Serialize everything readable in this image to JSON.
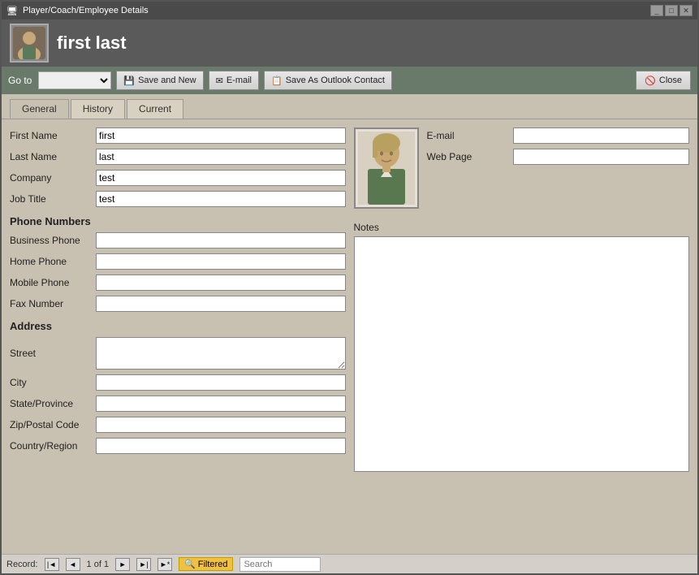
{
  "window": {
    "title": "Player/Coach/Employee Details",
    "controls": [
      "minimize",
      "maximize",
      "close"
    ]
  },
  "header": {
    "title": "first last",
    "icon_label": "person-icon"
  },
  "toolbar": {
    "goto_label": "Go to",
    "goto_placeholder": "",
    "save_new_label": "Save and New",
    "email_label": "E-mail",
    "save_outlook_label": "Save As Outlook Contact",
    "close_label": "Close"
  },
  "tabs": [
    {
      "id": "general",
      "label": "General",
      "active": true
    },
    {
      "id": "history",
      "label": "History",
      "active": false
    },
    {
      "id": "current",
      "label": "Current",
      "active": false
    }
  ],
  "form": {
    "first_name_label": "First Name",
    "first_name_value": "first",
    "last_name_label": "Last Name",
    "last_name_value": "last",
    "company_label": "Company",
    "company_value": "test",
    "job_title_label": "Job Title",
    "job_title_value": "test",
    "phone_numbers_title": "Phone Numbers",
    "business_phone_label": "Business Phone",
    "business_phone_value": "",
    "home_phone_label": "Home Phone",
    "home_phone_value": "",
    "mobile_phone_label": "Mobile Phone",
    "mobile_phone_value": "",
    "fax_number_label": "Fax Number",
    "fax_number_value": "",
    "address_title": "Address",
    "street_label": "Street",
    "street_value": "",
    "city_label": "City",
    "city_value": "",
    "state_label": "State/Province",
    "state_value": "",
    "zip_label": "Zip/Postal Code",
    "zip_value": "",
    "country_label": "Country/Region",
    "country_value": "",
    "email_label": "E-mail",
    "email_value": "",
    "web_page_label": "Web Page",
    "web_page_value": "",
    "notes_label": "Notes",
    "notes_value": ""
  },
  "status_bar": {
    "record_prefix": "Record:",
    "record_first": "◄◄",
    "record_prev": "◄",
    "record_info": "1 of 1",
    "record_next": "►",
    "record_last": "►►",
    "record_new": "►*",
    "filtered_label": "Filtered",
    "search_placeholder": "Search"
  }
}
